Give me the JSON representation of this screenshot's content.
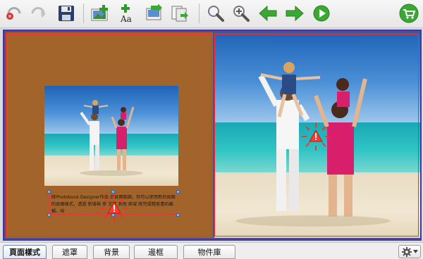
{
  "toolbar": {
    "buttons": [
      {
        "name": "undo",
        "icon": "undo-icon"
      },
      {
        "name": "redo",
        "icon": "redo-icon"
      },
      {
        "name": "save",
        "icon": "save-icon"
      },
      {
        "name": "add-photo",
        "icon": "add-photo-icon"
      },
      {
        "name": "add-text",
        "icon": "add-text-icon",
        "glyph": "Aa"
      },
      {
        "name": "import",
        "icon": "import-icon"
      },
      {
        "name": "export-pages",
        "icon": "export-pages-icon"
      },
      {
        "name": "zoom-out",
        "icon": "zoom-out-icon"
      },
      {
        "name": "zoom-in",
        "icon": "zoom-in-icon"
      },
      {
        "name": "previous-page",
        "icon": "arrow-left-icon"
      },
      {
        "name": "next-page",
        "icon": "arrow-right-icon"
      },
      {
        "name": "play-preview",
        "icon": "play-icon"
      },
      {
        "name": "cart",
        "icon": "shopping-cart-icon"
      }
    ],
    "colors": {
      "green": "#39a934",
      "red": "#d23a3a",
      "navy": "#2c3f66"
    }
  },
  "editor": {
    "left_page_color": "#a3642c",
    "bleed_color": "#ff2a2a",
    "spread_border_color": "#3a3aa8",
    "textbox_text": "將Photobook Designer作品 於頁面範圍，你可以使用新的頁面的頁面樣式，透過 新增與 使 文字 其他 區域 將完成精美書的編輯。按"
  },
  "tabs": [
    {
      "label": "頁面樣式",
      "active": true
    },
    {
      "label": "遮罩",
      "active": false
    },
    {
      "label": "背景",
      "active": false
    },
    {
      "label": "邊框",
      "active": false
    },
    {
      "label": "物件庫",
      "active": false
    }
  ],
  "settings_menu": {
    "icon": "gear-icon"
  }
}
